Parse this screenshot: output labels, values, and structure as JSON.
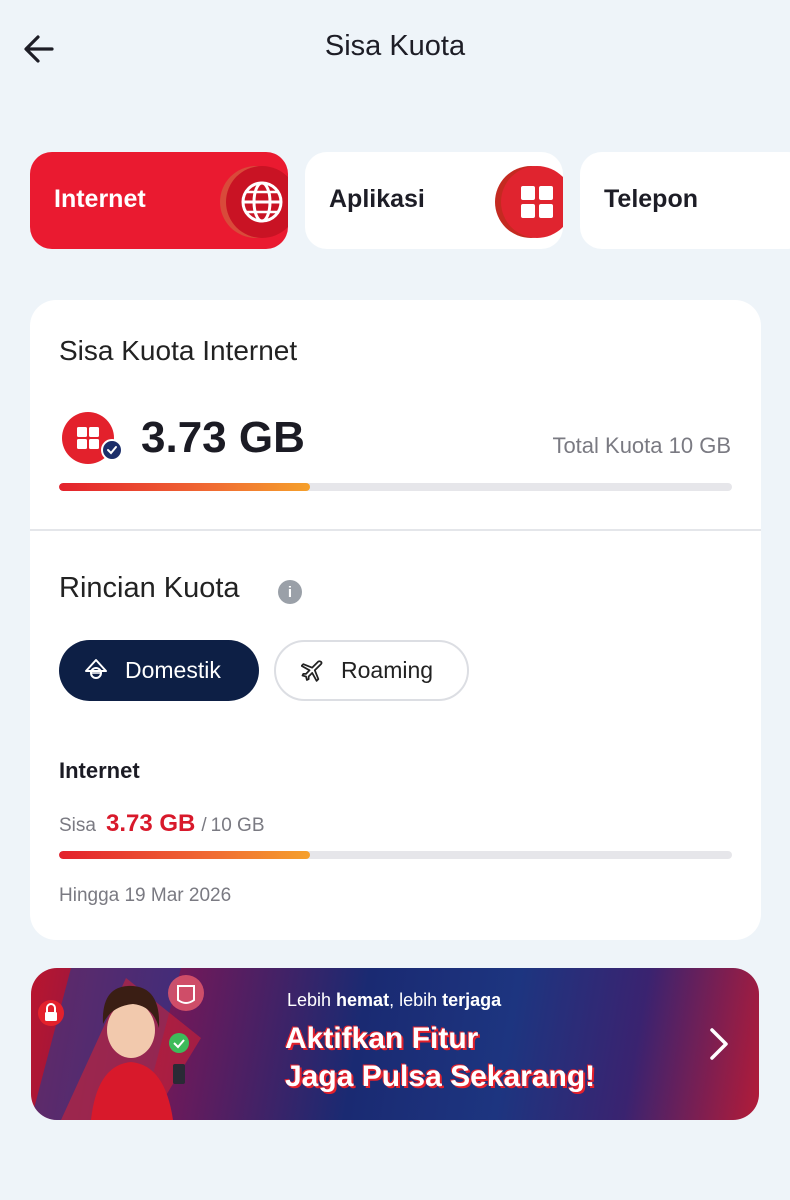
{
  "header": {
    "title": "Sisa Kuota"
  },
  "tabs": [
    {
      "label": "Internet",
      "active": true,
      "icon": "globe-icon"
    },
    {
      "label": "Aplikasi",
      "active": false,
      "icon": "apps-grid-icon"
    },
    {
      "label": "Telepon",
      "active": false,
      "icon": "phone-pin-icon"
    }
  ],
  "quota": {
    "title": "Sisa Kuota Internet",
    "remaining": "3.73 GB",
    "total_text": "Total Kuota 10 GB",
    "used_fraction": 0.373
  },
  "details": {
    "title": "Rincian Kuota",
    "filters": [
      {
        "label": "Domestik",
        "active": true,
        "icon": "domestic-icon"
      },
      {
        "label": "Roaming",
        "active": false,
        "icon": "airplane-icon"
      }
    ],
    "item": {
      "name": "Internet",
      "sisa_label": "Sisa",
      "remaining": "3.73 GB",
      "separator": "/",
      "total": "10 GB",
      "fraction": 0.373,
      "expiry": "Hingga 19 Mar 2026"
    }
  },
  "banner": {
    "kicker_pre": "Lebih ",
    "kicker_bold1": "hemat",
    "kicker_mid": ", lebih ",
    "kicker_bold2": "terjaga",
    "headline_line1": "Aktifkan Fitur",
    "headline_line2": "Jaga Pulsa Sekarang!"
  },
  "colors": {
    "brand_red": "#ea1a30",
    "navy": "#0d1f45",
    "background": "#eef4f9"
  }
}
